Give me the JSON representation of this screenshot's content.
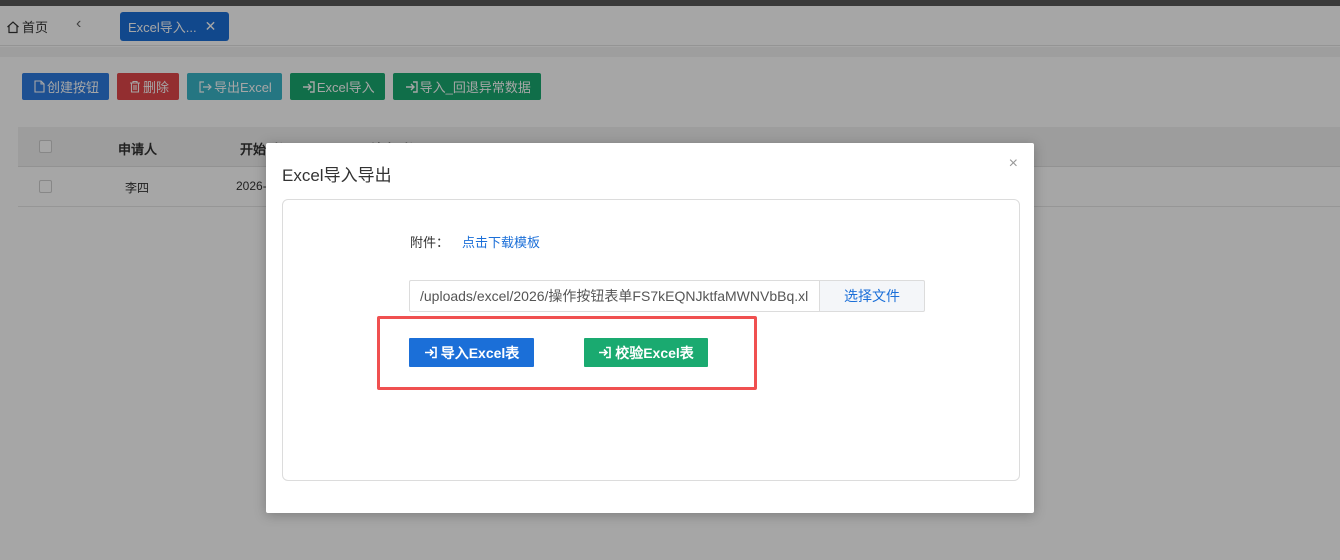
{
  "tabs": {
    "home_label": "首页",
    "back_glyph": "‹",
    "active_label": "Excel导入...",
    "close_glyph": "✕"
  },
  "toolbar": {
    "create_label": "创建按钮",
    "delete_label": "删除",
    "export_label": "导出Excel",
    "import_label": "Excel导入",
    "import_rollback_label": "导入_回退异常数据"
  },
  "table": {
    "headers": [
      "申请人",
      "开始时间",
      "结束时间"
    ],
    "rows": [
      {
        "applicant": "李四",
        "start": "2026-"
      }
    ]
  },
  "modal": {
    "title": "Excel导入导出",
    "close_glyph": "×",
    "attachment_label": "附件：",
    "download_link": "点击下载模板",
    "file_path": "/uploads/excel/2026/操作按钮表单FS7kEQNJktfaMWNVbBq.xl",
    "choose_file_label": "选择文件",
    "import_button": "导入Excel表",
    "verify_button": "校验Excel表"
  },
  "colors": {
    "primary": "#1b6fd8",
    "success": "#1aaa70",
    "danger": "#e2474a",
    "info": "#3ab5c8",
    "highlight": "#f05050"
  }
}
